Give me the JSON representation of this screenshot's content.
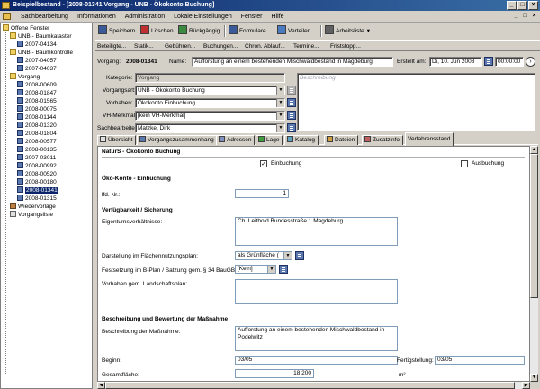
{
  "window": {
    "title": "Beispielbestand - [2008-01341 Vorgang - UNB - Ökokonto Buchung]",
    "buttons": [
      "_",
      "□",
      "×"
    ],
    "mdi_buttons": [
      "_",
      "□",
      "×"
    ]
  },
  "menu": [
    "Sachbearbeitung",
    "Informationen",
    "Administration",
    "Lokale Einstellungen",
    "Fenster",
    "Hilfe"
  ],
  "tree": {
    "items": [
      {
        "label": "Offene Fenster",
        "icon": "folder-icon"
      },
      {
        "label": "UNB - Baumkataster",
        "icon": "folder-icon"
      },
      {
        "label": "2007-04134",
        "icon": "document-icon"
      },
      {
        "label": "UNB - Baumkontrolle",
        "icon": "folder-icon"
      },
      {
        "label": "2007-04057",
        "icon": "document-icon"
      },
      {
        "label": "2007-04037",
        "icon": "document-icon"
      },
      {
        "label": "Vorgang",
        "icon": "folder-icon"
      },
      {
        "label": "2008-00609",
        "icon": "document-icon"
      },
      {
        "label": "2008-01847",
        "icon": "document-icon"
      },
      {
        "label": "2008-01565",
        "icon": "document-icon"
      },
      {
        "label": "2008-00075",
        "icon": "document-icon"
      },
      {
        "label": "2008-01144",
        "icon": "document-icon"
      },
      {
        "label": "2008-01320",
        "icon": "document-icon"
      },
      {
        "label": "2008-01804",
        "icon": "document-icon"
      },
      {
        "label": "2008-00577",
        "icon": "document-icon"
      },
      {
        "label": "2008-00135",
        "icon": "document-icon"
      },
      {
        "label": "2007-03011",
        "icon": "document-icon"
      },
      {
        "label": "2008-00992",
        "icon": "document-icon"
      },
      {
        "label": "2008-00520",
        "icon": "document-icon"
      },
      {
        "label": "2008-00180",
        "icon": "document-icon"
      },
      {
        "label": "2008-01341",
        "icon": "document-icon",
        "selected": true
      },
      {
        "label": "2008-01315",
        "icon": "document-icon"
      },
      {
        "label": "Wiedervorlage",
        "icon": "tools-icon"
      },
      {
        "label": "Vorgangsliste",
        "icon": "list-icon"
      }
    ]
  },
  "toolbar": {
    "save": "Speichern",
    "delete": "Löschen",
    "reset": "Rückgängig",
    "forms": "Formulare...",
    "distributor": "Verteiler...",
    "worklist": "Arbeitsliste"
  },
  "subtoolbar": [
    "Beteiligte...",
    "Statik...",
    "Gebühren...",
    "Buchungen...",
    "Chron. Ablauf...",
    "Termine...",
    "Friststopp..."
  ],
  "header": {
    "vorgang_label": "Vorgang:",
    "vorgang_value": "2008-01341",
    "name_label": "Name:",
    "name_value": "Aufforstung an einem bestehenden Mischwaldbestand in Magdeburg",
    "created_label": "Erstellt am:",
    "created_date": "Di, 10. Jun 2008",
    "created_time": "00:00:00",
    "kategorie_label": "Kategorie:",
    "kategorie_value": "Vorgang",
    "vorgangsart_label": "Vorgangsart:",
    "vorgangsart_value": "UNB - Ökokonto Buchung",
    "vorhaben_label": "Vorhaben:",
    "vorhaben_value": "Ökokonto Einbuchung",
    "vh_label": "VH-Merkmal:",
    "vh_value": "[kein VH-Merkmal]",
    "sb_label": "Sachbearbeiter:",
    "sb_value": "Matzke, Dirk",
    "beschreibung_placeholder": "Beschreibung"
  },
  "tabs": [
    {
      "label": "Übersicht"
    },
    {
      "label": "Vorgangszusammenhang"
    },
    {
      "label": "Adressen"
    },
    {
      "label": "Lage"
    },
    {
      "label": "Katalog"
    },
    {
      "label": "Dateien"
    },
    {
      "label": "Zusatzinfo"
    },
    {
      "label": "Verfahrensstand",
      "active": true
    }
  ],
  "content": {
    "natur_title": "NaturS - Ökokonto Buchung",
    "einbuchung": "Einbuchung",
    "einbuchung_checked": "✓",
    "ausbuchung": "Ausbuchung",
    "ausbuchung_checked": "",
    "sec_einbuchung": "Öko-Konto - Einbuchung",
    "lfd_label": "lfd. Nr.:",
    "lfd_value": "1",
    "sec_verf": "Verfügbarkeit / Sicherung",
    "eigentum_label": "Eigentumsverhältnisse:",
    "eigentum_value": "Ch. Leithold Bundesstraße 1 Magdeburg",
    "darstellung_label": "Darstellung im Flächennutzungsplan:",
    "darstellung_value": "als  Grünfläche (",
    "festsetzung_label": "Festsetzung im B-Plan / Satzung gem. § 34 BauGB:",
    "festsetzung_value": "[Kein]",
    "vorhaben_land_label": "Vorhaben gem. Landschaftsplan:",
    "vorhaben_land_value": "",
    "sec_bewertung": "Beschreibung und Bewertung der Maßnahme",
    "massnahme_label": "Beschreibung der Maßnahme:",
    "massnahme_value": "Aufforstung an einem bestehenden Mischwaldbestand in\nPodelwitz",
    "beginn_label": "Beginn:",
    "beginn_value": "03/05",
    "fertig_label": "Fertigstellung:",
    "fertig_value": "03/05",
    "gesamt_label": "Gesamtfläche:",
    "gesamt_value": "18.200",
    "unit": "m²"
  }
}
